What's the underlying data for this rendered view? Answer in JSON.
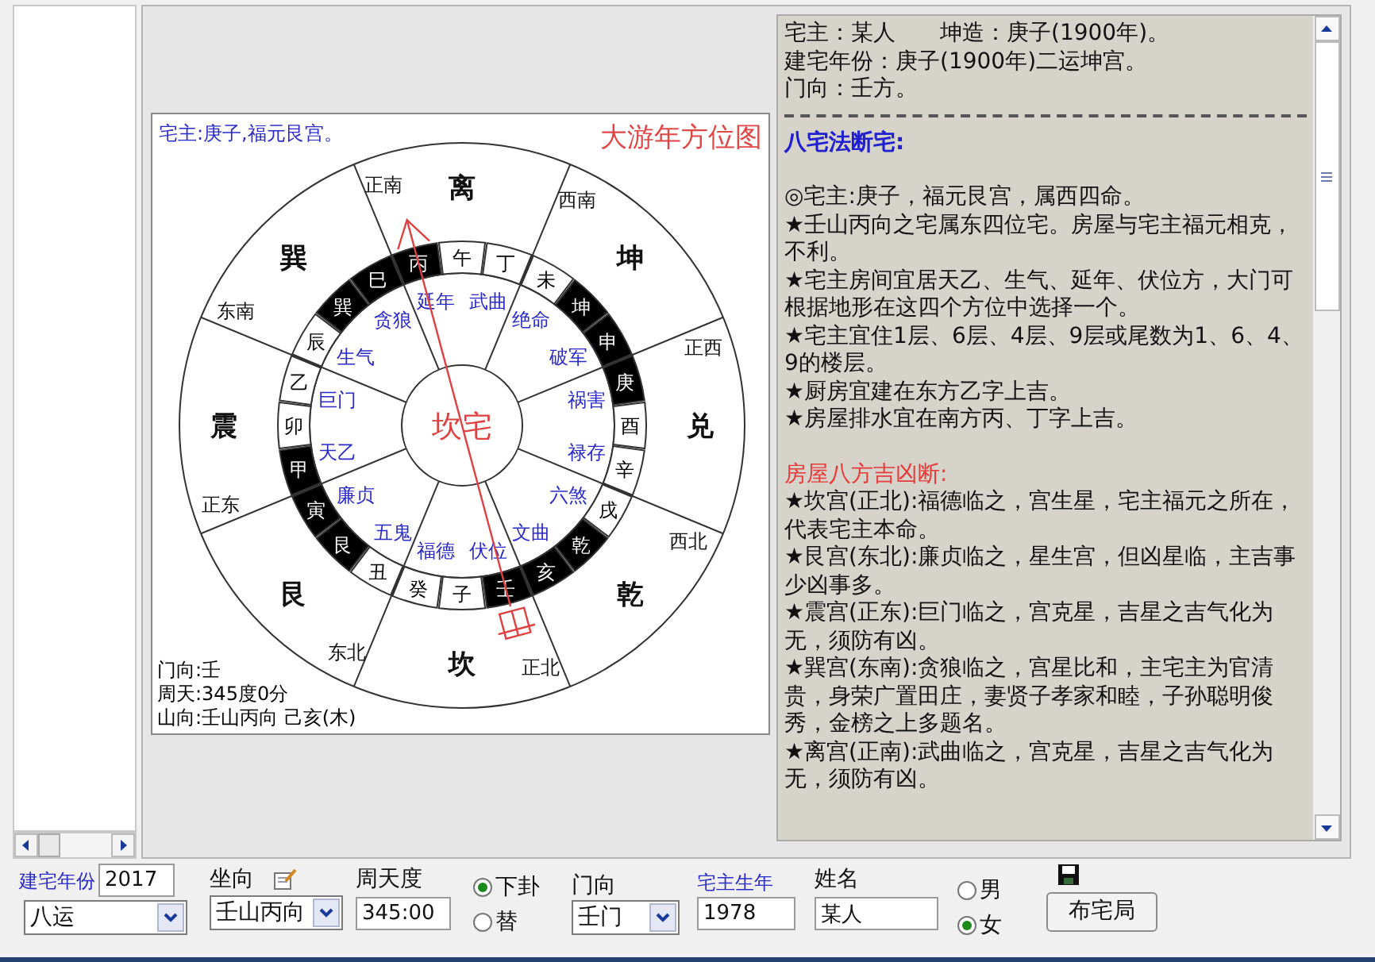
{
  "diagram": {
    "owner_note": "宅主:庚子,福元艮宫。",
    "title": "大游年方位图",
    "center_label": "坎宅",
    "sectors": [
      {
        "trigram": "离",
        "direction": "正南",
        "you_nian": "延年",
        "star": "武曲"
      },
      {
        "trigram": "巽",
        "direction": "东南",
        "you_nian": "生气",
        "star": "贪狼"
      },
      {
        "trigram": "坤",
        "direction": "西南",
        "you_nian": "绝命",
        "star": "破军"
      },
      {
        "trigram": "震",
        "direction": "正东",
        "you_nian": "天乙",
        "star": "巨门"
      },
      {
        "trigram": "兑",
        "direction": "正西",
        "you_nian": "祸害",
        "star": "禄存"
      },
      {
        "trigram": "艮",
        "direction": "东北",
        "you_nian": "五鬼",
        "star": "廉贞"
      },
      {
        "trigram": "乾",
        "direction": "西北",
        "you_nian": "六煞",
        "star": "文曲"
      },
      {
        "trigram": "坎",
        "direction": "正北",
        "you_nian": "伏位",
        "star": "福德"
      }
    ],
    "mountains": [
      {
        "label": "丙",
        "filled": true
      },
      {
        "label": "午",
        "filled": false
      },
      {
        "label": "丁",
        "filled": false
      },
      {
        "label": "巳",
        "filled": true
      },
      {
        "label": "未",
        "filled": false
      },
      {
        "label": "巽",
        "filled": true
      },
      {
        "label": "坤",
        "filled": true
      },
      {
        "label": "辰",
        "filled": false
      },
      {
        "label": "申",
        "filled": true
      },
      {
        "label": "乙",
        "filled": false
      },
      {
        "label": "庚",
        "filled": true
      },
      {
        "label": "卯",
        "filled": false
      },
      {
        "label": "酉",
        "filled": false
      },
      {
        "label": "甲",
        "filled": true
      },
      {
        "label": "辛",
        "filled": false
      },
      {
        "label": "寅",
        "filled": true
      },
      {
        "label": "戌",
        "filled": false
      },
      {
        "label": "艮",
        "filled": true
      },
      {
        "label": "乾",
        "filled": true
      },
      {
        "label": "丑",
        "filled": false
      },
      {
        "label": "亥",
        "filled": true
      },
      {
        "label": "癸",
        "filled": false
      },
      {
        "label": "子",
        "filled": false
      },
      {
        "label": "壬",
        "filled": true
      }
    ],
    "footer_lines": [
      "门向:壬",
      "周天:345度0分",
      "山向:壬山丙向 己亥(木)"
    ]
  },
  "report": {
    "header": [
      [
        "宅主：某人",
        "坤造：庚子(1900年)。"
      ],
      [
        "建宅年份：庚子(1900年)二运坤宫。"
      ],
      [
        "门向：壬方。"
      ]
    ],
    "sections": [
      {
        "title": "八宅法断宅:",
        "color": "#2020d0",
        "bold": true,
        "paragraphs": [
          "◎宅主:庚子，福元艮宫，属西四命。",
          "★壬山丙向之宅属东四位宅。房屋与宅主福元相克，不利。",
          "★宅主房间宜居天乙、生气、延年、伏位方，大门可根据地形在这四个方位中选择一个。",
          "★宅主宜住1层、6层、4层、9层或尾数为1、6、4、9的楼层。",
          "★厨房宜建在东方乙字上吉。",
          "★房屋排水宜在南方丙、丁字上吉。"
        ]
      },
      {
        "title": "房屋八方吉凶断:",
        "color": "#e83a3a",
        "bold": false,
        "paragraphs": [
          "★坎宫(正北):福德临之，宫生星，宅主福元之所在，代表宅主本命。",
          "★艮宫(东北):廉贞临之，星生宫，但凶星临，主吉事少凶事多。",
          "★震宫(正东):巨门临之，宫克星，吉星之吉气化为无，须防有凶。",
          "★巽宫(东南):贪狼临之，宫星比和，主宅主为官清贵，身荣广置田庄，妻贤子孝家和睦，子孙聪明俊秀，金榜之上多题名。",
          "★离宫(正南):武曲临之，宫克星，吉星之吉气化为无，须防有凶。"
        ]
      }
    ]
  },
  "toolbar": {
    "build_year": {
      "label": "建宅年份",
      "value": "2017"
    },
    "period": {
      "value": "八运"
    },
    "facing": {
      "label": "坐向",
      "value": "壬山丙向"
    },
    "degree": {
      "label": "周天度",
      "value": "345:00"
    },
    "gua_options": [
      {
        "label": "下卦",
        "selected": true
      },
      {
        "label": "替",
        "selected": false
      }
    ],
    "door": {
      "label": "门向",
      "value": "壬门"
    },
    "owner_birth_year": {
      "label": "宅主生年",
      "value": "1978"
    },
    "name": {
      "label": "姓名",
      "value": "某人"
    },
    "gender_options": [
      {
        "label": "男",
        "selected": false
      },
      {
        "label": "女",
        "selected": true
      }
    ],
    "submit_button": "布宅局"
  }
}
